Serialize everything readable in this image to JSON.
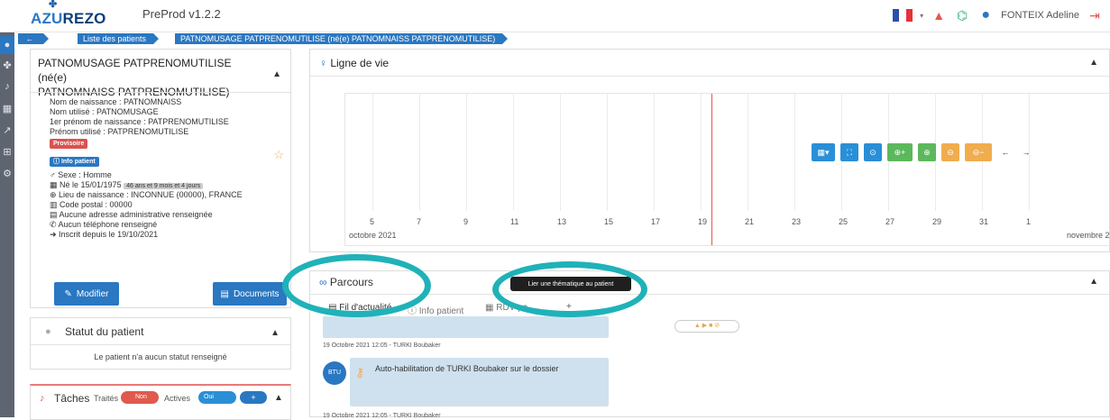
{
  "header": {
    "logo_text": "AZUREZO",
    "logo_mark": "✤",
    "version": "PreProd v1.2.2",
    "user_name": "FONTEIX Adeline",
    "icons": [
      "flag-fr",
      "alert-icon",
      "connections-icon",
      "user-avatar-icon",
      "logout-icon"
    ]
  },
  "breadcrumb": {
    "back": "←",
    "items": [
      "Liste des patients",
      "PATNOMUSAGE PATPRENOMUTILISE (né(e) PATNOMNAISS PATPRENOMUTILISE)"
    ]
  },
  "sidenav": {
    "icons": [
      "user-icon",
      "azurezo-icon",
      "bell-icon",
      "calendar-icon",
      "chart-icon",
      "table-icon",
      "settings-icon"
    ]
  },
  "patient": {
    "title_line1": "PATNOMUSAGE PATPRENOMUTILISE (né(e)",
    "title_line2": "PATNOMNAISS PATPRENOMUTILISE)",
    "nom_naissance": "Nom de naissance : PATNOMNAISS",
    "nom_utilise": "Nom utilisé : PATNOMUSAGE",
    "prenom_naissance": "1er prénom de naissance : PATPRENOMUTILISE",
    "prenom_utilise": "Prénom utilisé : PATPRENOMUTILISE",
    "provisoire_badge": "Provisoire",
    "info_badge": "Info patient",
    "sexe": "Sexe : Homme",
    "ne_le": "Né le 15/01/1975",
    "age_badge": "46 ans et 9 mois et 4 jours",
    "lieu": "Lieu de naissance : INCONNUE (00000), FRANCE",
    "code_postal": "Code postal : 00000",
    "adresse": "Aucune adresse administrative renseignée",
    "telephone": "Aucun téléphone renseigné",
    "inscrit": "Inscrit depuis le 19/10/2021",
    "btn_modifier": "Modifier",
    "btn_documents": "Documents"
  },
  "status": {
    "title": "Statut du patient",
    "text": "Le patient n'a aucun statut renseigné"
  },
  "tasks": {
    "title": "Tâches",
    "traites_label": "Traités",
    "traites_toggle": "Non",
    "actives_label": "Actives",
    "actives_toggle": "Oui"
  },
  "timeline": {
    "title": "Ligne de vie",
    "ticks": [
      "5",
      "7",
      "9",
      "11",
      "13",
      "15",
      "17",
      "19",
      "21",
      "23",
      "25",
      "27",
      "29",
      "31",
      "1"
    ],
    "month_start": "octobre 2021",
    "month_end": "novembre 2",
    "nav_left": "←",
    "nav_right": "→",
    "colors": {
      "blue": "#2a8fd6",
      "green": "#5cb85c",
      "yellow": "#f0ad4e",
      "current": "#e05a4e"
    }
  },
  "parcours": {
    "title": "Parcours",
    "tooltip": "Lier une thématique au patient",
    "tabs": [
      "Fil d'actualité",
      "Info patient",
      "RDV pa"
    ],
    "event1_date": "19 Octobre 2021 12:05 - TURKI Boubaker",
    "event1_avatar": "BTU",
    "event1_text": "Auto-habilitation de TURKI Boubaker sur le dossier",
    "event2_date": "19 Octobre 2021 12:05 - TURKI Boubaker"
  },
  "highlight_color": "#1fb2b8"
}
